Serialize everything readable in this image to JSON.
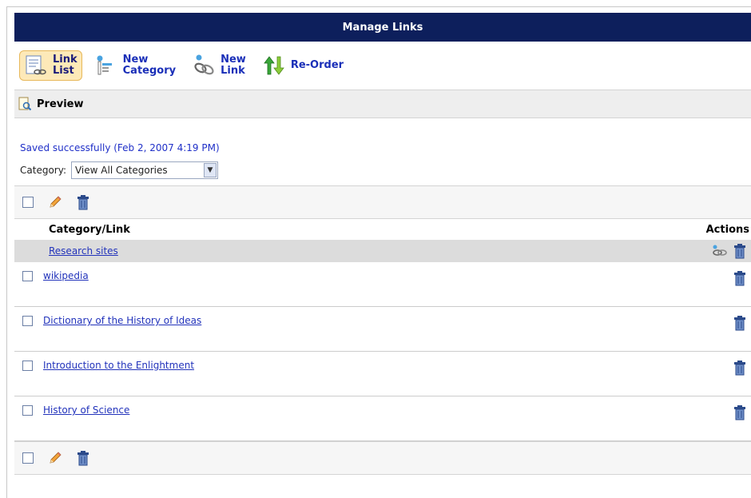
{
  "header": {
    "title": "Manage Links"
  },
  "toolbar": {
    "link_list": {
      "line1": "Link",
      "line2": "List"
    },
    "new_category": {
      "line1": "New",
      "line2": "Category"
    },
    "new_link": {
      "line1": "New",
      "line2": "Link"
    },
    "reorder": "Re-Order"
  },
  "preview": {
    "label": "Preview"
  },
  "status": "Saved successfully (Feb 2, 2007 4:19 PM)",
  "category_filter": {
    "label": "Category:",
    "selected": "View All Categories"
  },
  "columns": {
    "name": "Category/Link",
    "actions": "Actions"
  },
  "categories": [
    {
      "name": "Research sites",
      "links": [
        "wikipedia",
        "Dictionary of the History of Ideas",
        "Introduction to the Enlightment",
        "History of Science"
      ]
    }
  ],
  "icons": {
    "link_list": "link-list-icon",
    "new_category": "new-category-icon",
    "new_link": "new-link-icon",
    "reorder": "reorder-icon",
    "preview": "preview-icon",
    "edit": "pencil-icon",
    "delete": "trash-icon",
    "add_link": "add-link-icon"
  },
  "colors": {
    "titlebar": "#0d1f5c",
    "link": "#2233bb",
    "status": "#2030c8"
  }
}
